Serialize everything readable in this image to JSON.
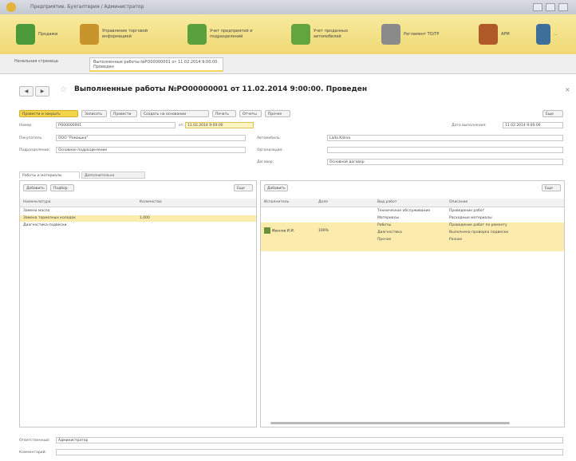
{
  "window": {
    "title": "Предприятие. Бухгалтерия / Администратор"
  },
  "toolbar": {
    "items": [
      {
        "label": "Продажи",
        "icon": "person-icon",
        "color": "#4c9a3a"
      },
      {
        "label": "Управление торговой информацией",
        "icon": "boxes-icon",
        "color": "#c8952c"
      },
      {
        "label": "Учет предприятий и подразделений",
        "icon": "handshake-icon",
        "color": "#5aa03c"
      },
      {
        "label": "Учет проданных автомобилей",
        "icon": "worker-icon",
        "color": "#62a53e"
      },
      {
        "label": "Регламент ТО/ТР",
        "icon": "trophy-icon",
        "color": "#8a8a8a"
      },
      {
        "label": "АРМ",
        "icon": "car-icon",
        "color": "#b05a2a"
      },
      {
        "label": "...",
        "icon": "person-tie-icon",
        "color": "#3e6e9a"
      }
    ]
  },
  "tabs": [
    {
      "label": "Начальная страница"
    },
    {
      "label": "Выполненные работы №РО00000001 от 11.02.2014 9:00:00. Проведен"
    }
  ],
  "document": {
    "title": "Выполненные работы №РО00000001 от 11.02.2014 9:00:00. Проведен",
    "nav_back": "◀",
    "nav_forward": "▶",
    "star": "☆",
    "close": "×"
  },
  "command_bar": {
    "buttons": [
      {
        "label": "Провести и закрыть",
        "primary": true
      },
      {
        "label": "Записать"
      },
      {
        "label": "Провести"
      },
      {
        "label": "Создать на основании"
      },
      {
        "label": "Печать"
      },
      {
        "label": "Отчеты"
      },
      {
        "label": "Прочее"
      }
    ],
    "more": "Еще"
  },
  "form": {
    "number_label": "Номер:",
    "number_value": "РО00000001",
    "date_label": "от:",
    "date_value": "11.02.2014 9:00:00",
    "plan_date_label": "Дата выполнения:",
    "plan_date_value": "11.02.2014 9:00:00",
    "client_label": "Покупатель:",
    "client_value": "ООО \"Ромашка\"",
    "dept_label": "Подразделение:",
    "dept_value": "Основное подразделение",
    "car_label": "Автомобиль:",
    "car_value": "Lada Kalina",
    "org_label": "Организация:",
    "org_value": "",
    "contract_label": "Договор:",
    "contract_value": "Основной договор"
  },
  "inner_tabs": [
    {
      "label": "Работы и материалы"
    },
    {
      "label": "Дополнительно"
    }
  ],
  "left_table": {
    "toolbar": {
      "add": "Добавить",
      "pick": "Подбор",
      "more": "Еще"
    },
    "headers": [
      "Номенклатура",
      "Количество"
    ],
    "rows": [
      {
        "name": "Замена масла",
        "qty": "",
        "selected": false
      },
      {
        "name": "Замена тормозных колодок",
        "qty": "1,000",
        "selected": true
      },
      {
        "name": "Диагностика подвески",
        "qty": "",
        "selected": false
      }
    ]
  },
  "right_table": {
    "toolbar": {
      "add": "Добавить",
      "more": "Еще"
    },
    "headers": [
      "Исполнитель",
      "Доля",
      "Вид работ",
      "Описание"
    ],
    "rows": [
      {
        "c3": "Техническое обслуживание",
        "c4": "Проведение работ",
        "selected": false
      },
      {
        "c3": "Материалы",
        "c4": "Расходные материалы",
        "selected": false
      },
      {
        "c3": "Работы",
        "c4": "Проведение работ по ремонту",
        "selected": true
      },
      {
        "c3": "Диагностика",
        "c4": "Выполнена проверка подвески",
        "selected": true
      },
      {
        "c3": "Прочее",
        "c4": "Разное",
        "selected": true
      }
    ],
    "selected_group": {
      "executor": "Иванов И.И.",
      "share": "100%"
    }
  },
  "footer": {
    "responsible_label": "Ответственный:",
    "responsible_value": "Администратор",
    "comment_label": "Комментарий:",
    "comment_value": ""
  }
}
